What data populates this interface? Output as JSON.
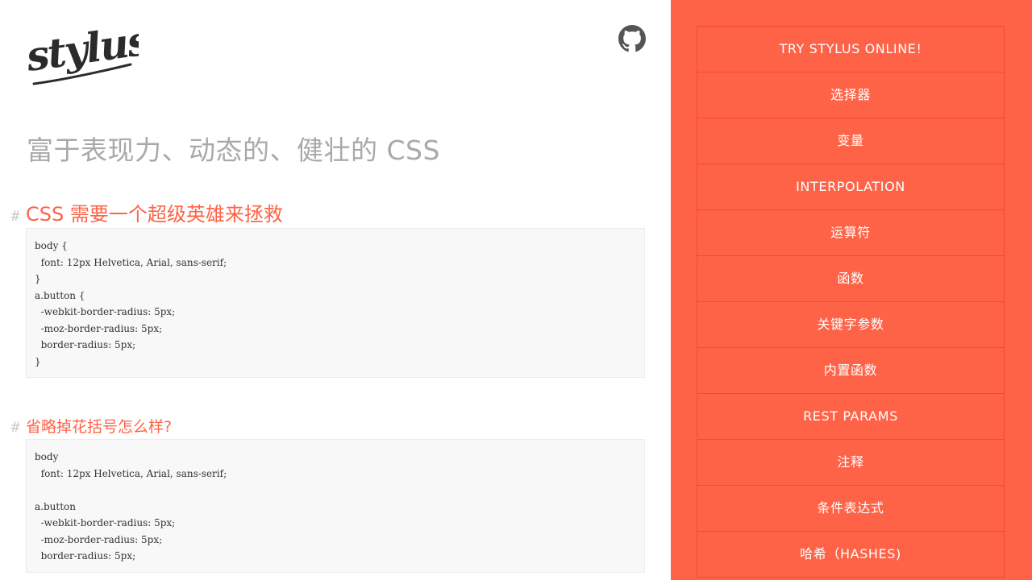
{
  "brand": {
    "logo_text": "stylus",
    "github_icon": "github-octocat-icon"
  },
  "tagline": "富于表现力、动态的、健壮的 CSS",
  "sections": [
    {
      "hash": "#",
      "title": "CSS 需要一个超级英雄来拯救",
      "code": "body {\n  font: 12px Helvetica, Arial, sans-serif;\n}\na.button {\n  -webkit-border-radius: 5px;\n  -moz-border-radius: 5px;\n  border-radius: 5px;\n}"
    },
    {
      "hash": "#",
      "title": "省略掉花括号怎么样?",
      "code": "body\n  font: 12px Helvetica, Arial, sans-serif;\n\na.button\n  -webkit-border-radius: 5px;\n  -moz-border-radius: 5px;\n  border-radius: 5px;"
    }
  ],
  "nav": {
    "items": [
      "TRY STYLUS ONLINE!",
      "选择器",
      "变量",
      "INTERPOLATION",
      "运算符",
      "函数",
      "关键字参数",
      "内置函数",
      "REST PARAMS",
      "注释",
      "条件表达式",
      "哈希（HASHES)"
    ]
  },
  "colors": {
    "accent": "#ff6347",
    "sidebar_border": "#f24a2d",
    "tagline": "#a9a9a9",
    "code_bg": "#f8f8f8"
  }
}
